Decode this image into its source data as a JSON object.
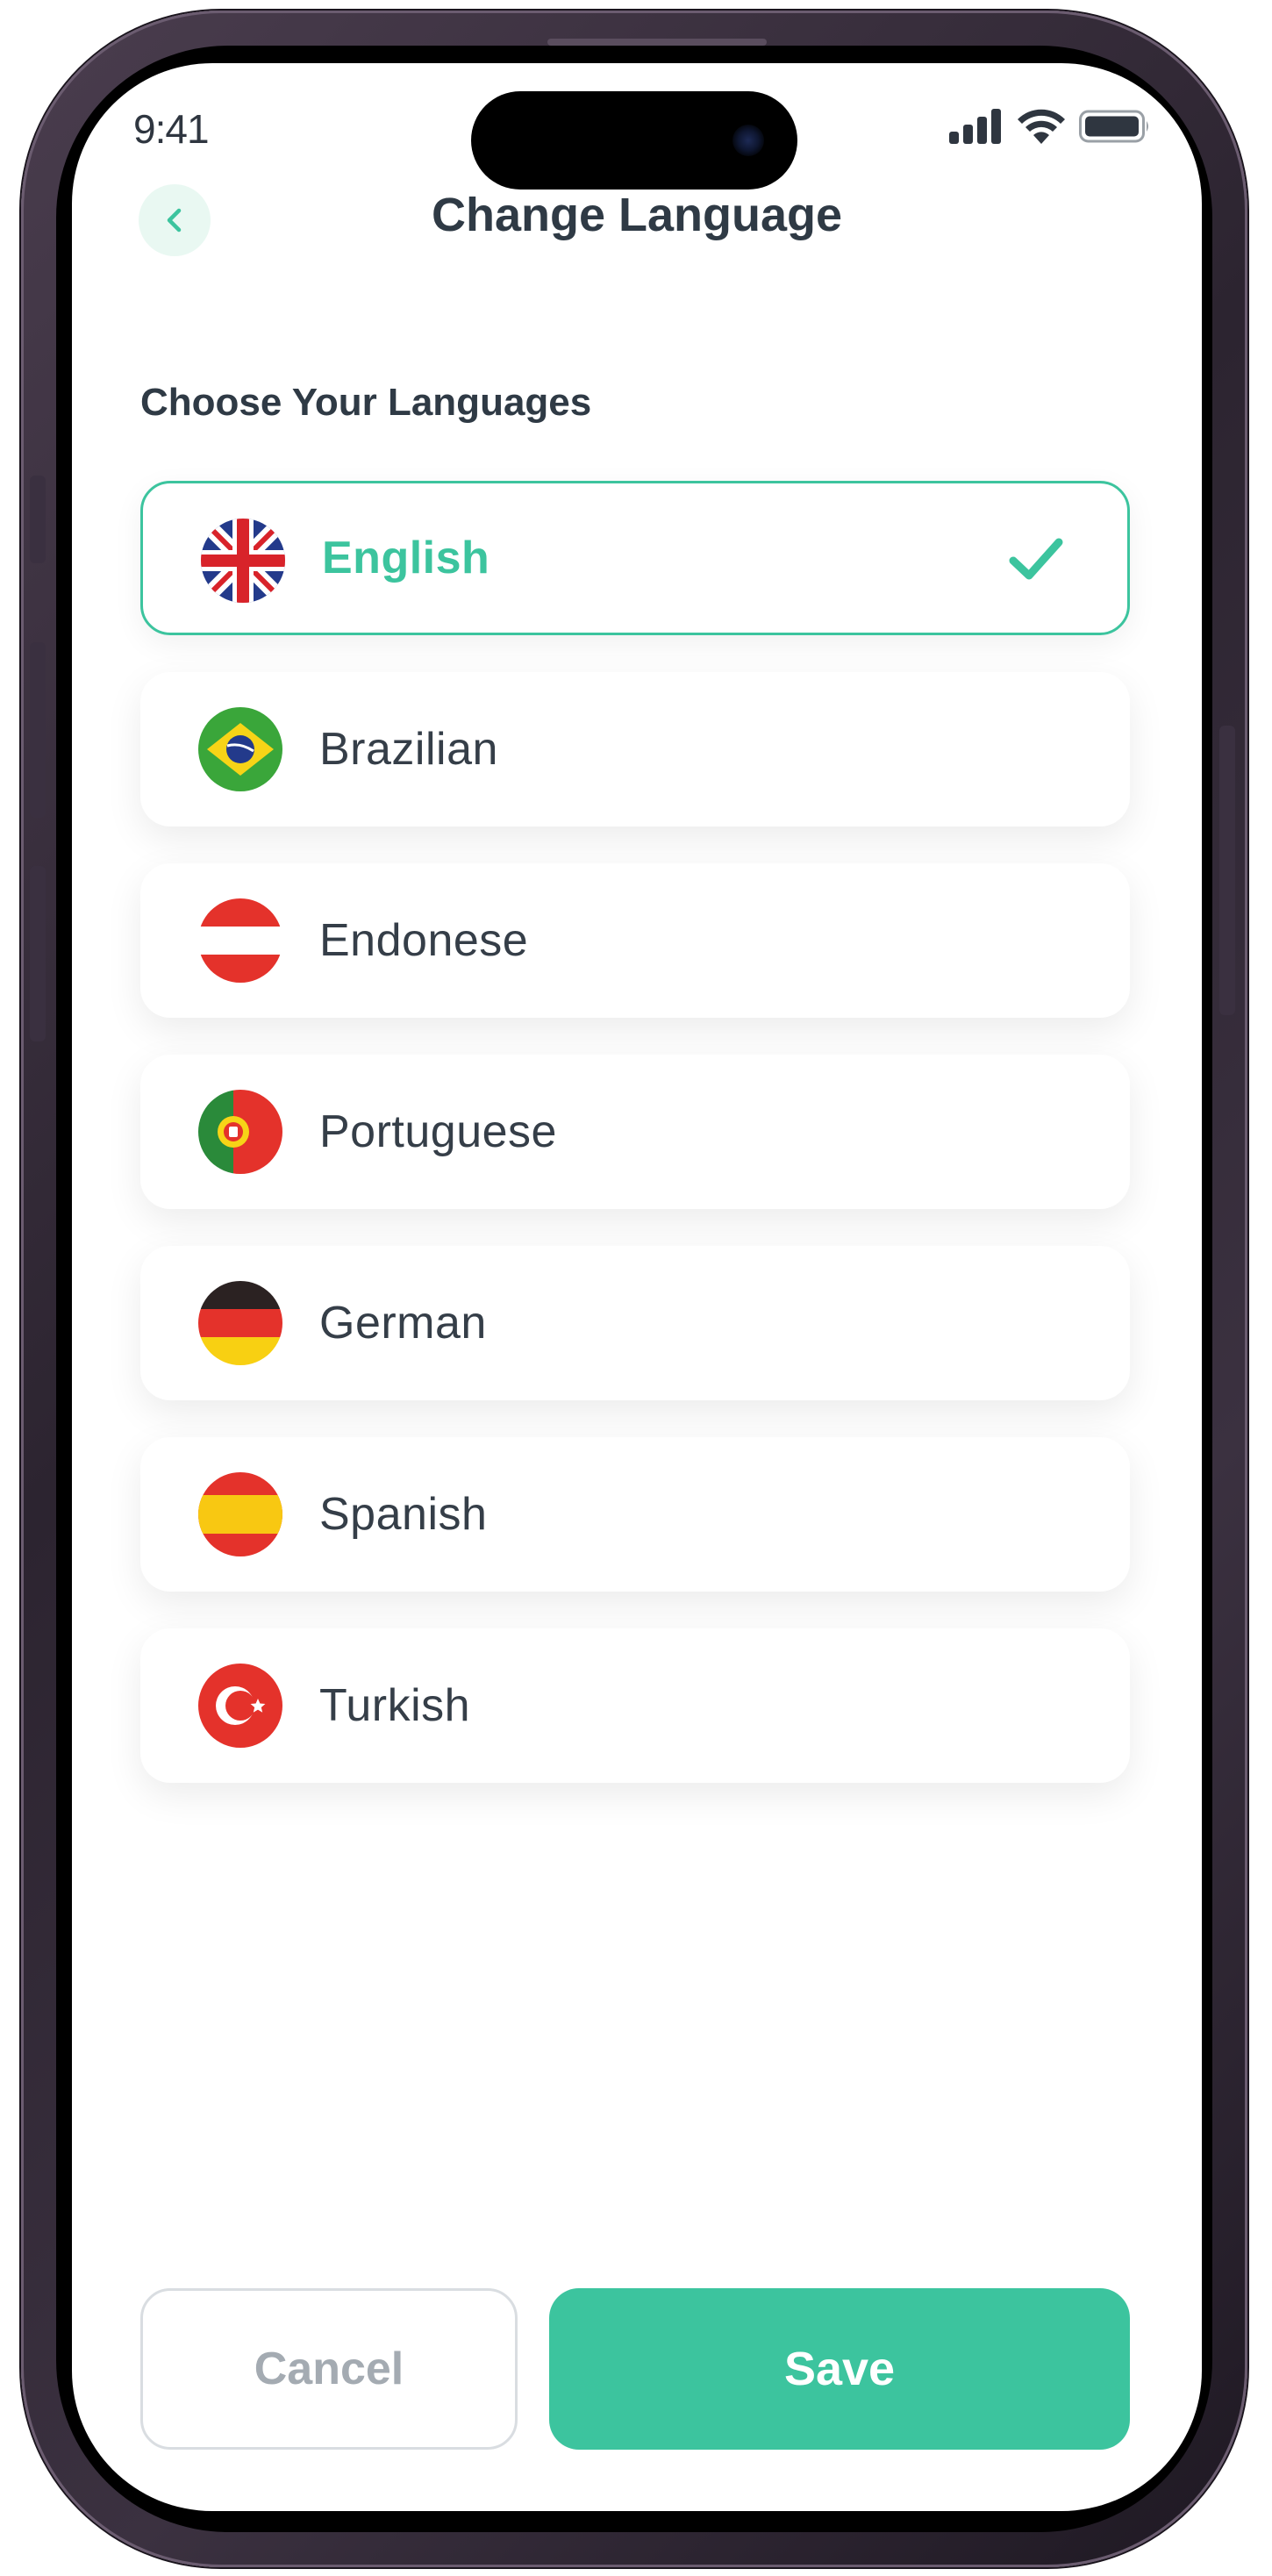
{
  "status_bar": {
    "time": "9:41",
    "icons": [
      "cellular-signal-icon",
      "wifi-icon",
      "battery-icon"
    ]
  },
  "header": {
    "back_icon": "chevron-left-icon",
    "title": "Change Language"
  },
  "section": {
    "title": "Choose Your Languages"
  },
  "languages": [
    {
      "label": "English",
      "flag": "uk-flag-icon",
      "selected": true
    },
    {
      "label": "Brazilian",
      "flag": "brazil-flag-icon",
      "selected": false
    },
    {
      "label": "Endonese",
      "flag": "austria-flag-icon",
      "selected": false
    },
    {
      "label": "Portuguese",
      "flag": "portugal-flag-icon",
      "selected": false
    },
    {
      "label": "German",
      "flag": "germany-flag-icon",
      "selected": false
    },
    {
      "label": "Spanish",
      "flag": "spain-flag-icon",
      "selected": false
    },
    {
      "label": "Turkish",
      "flag": "turkey-flag-icon",
      "selected": false
    }
  ],
  "actions": {
    "cancel_label": "Cancel",
    "save_label": "Save"
  },
  "colors": {
    "accent": "#3cc49e",
    "text_dark": "#2f3a45",
    "back_button_bg": "#e9f8f2",
    "cancel_text": "#a4abb2"
  }
}
